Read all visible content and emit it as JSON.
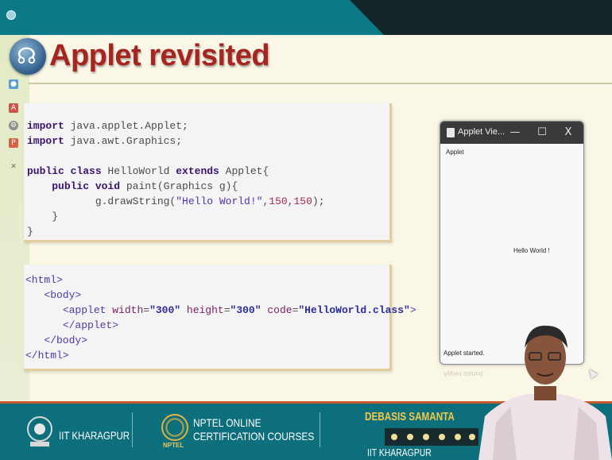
{
  "slide": {
    "title": "Applet revisited"
  },
  "java_code": {
    "lines": [
      [
        "kw:import",
        "t: java.applet.Applet;"
      ],
      [
        "kw:import",
        "t: java.awt.Graphics;"
      ],
      [],
      [
        "kw:public class",
        "t: HelloWorld ",
        "kw:extends",
        "t: Applet{"
      ],
      [
        "t:    ",
        "kw:public void",
        "t: paint(Graphics g){"
      ],
      [
        "t:           g.drawString(",
        "s:\"Hello World!\"",
        "t:,",
        "n:150",
        "t:,",
        "n:150",
        "t:);"
      ],
      [
        "t:    }"
      ],
      [
        "t:}"
      ]
    ]
  },
  "html_code": {
    "lines": [
      [
        "g:<html>"
      ],
      [
        "t:   ",
        "g:<body>"
      ],
      [
        "t:      ",
        "g:<applet ",
        "a:width",
        "t:=",
        "v:\"300\"",
        "t: ",
        "a:height",
        "t:=",
        "v:\"300\"",
        "t: ",
        "a:code",
        "t:=",
        "v:\"HelloWorld.class\"",
        "g:>"
      ],
      [
        "t:      ",
        "g:</applet>"
      ],
      [
        "t:   ",
        "g:</body>"
      ],
      [
        "g:</html>"
      ]
    ]
  },
  "applet_window": {
    "title": "Applet Vie...",
    "minimize": "—",
    "maximize": "☐",
    "close": "X",
    "menu": "Applet",
    "content": "Hello World !",
    "status": "Applet started."
  },
  "footer": {
    "institute": "IIT KHARAGPUR",
    "program_line1": "NPTEL ONLINE",
    "program_line2": "CERTIFICATION COURSES",
    "program_logo_caption": "NPTEL",
    "presenter_name": "DEBASIS SAMANTA",
    "presenter_institute": "IIT KHARAGPUR"
  },
  "colors": {
    "title": "#a8251f",
    "top_bar": "#0c7a86",
    "footer": "#0d6f7b",
    "presenter_name": "#f4c84a"
  }
}
